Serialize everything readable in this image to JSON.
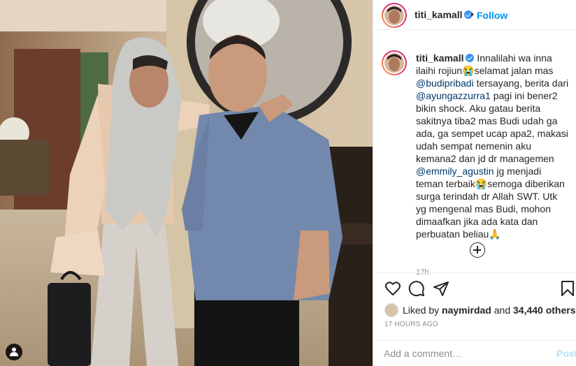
{
  "post": {
    "username": "titi_kamall",
    "follow_label": "Follow",
    "dot": "•"
  },
  "caption": {
    "username": "titi_kamall",
    "segments": [
      {
        "text": "Innalilahi wa inna ilaihi rojiun😭selamat jalan mas ",
        "mention": false
      },
      {
        "text": "@budipribadi",
        "mention": true
      },
      {
        "text": " tersayang, berita dari ",
        "mention": false
      },
      {
        "text": "@ayungazzurra1",
        "mention": true
      },
      {
        "text": " pagi ini bener2 bikin shock. Aku gatau berita sakitnya tiba2 mas Budi udah ga ada, ga sempet ucap apa2, makasi udah sempat nemenin aku kemana2 dan jd dr managemen ",
        "mention": false
      },
      {
        "text": "@emmily_agustin",
        "mention": true
      },
      {
        "text": " jg menjadi teman terbaik😭semoga diberikan surga terindah dr Allah SWT. Utk yg mengenal mas Budi, mohon dimaafkan jika ada kata dan perbuatan beliau🙏",
        "mention": false
      }
    ],
    "time": "17h"
  },
  "actions": {
    "icons": [
      "heart-icon",
      "comment-icon",
      "share-icon",
      "bookmark-icon"
    ]
  },
  "likes": {
    "prefix": "Liked by ",
    "user": "naymirdad",
    "middle": " and ",
    "count": "34,440 others"
  },
  "posted_time": "17 HOURS AGO",
  "comment": {
    "placeholder": "Add a comment…",
    "post_label": "Post"
  },
  "colors": {
    "link": "#0095f6",
    "mention": "#00376b",
    "verified": "#3897f0",
    "muted": "#8e8e8e",
    "post_disabled": "#b2dffc"
  }
}
